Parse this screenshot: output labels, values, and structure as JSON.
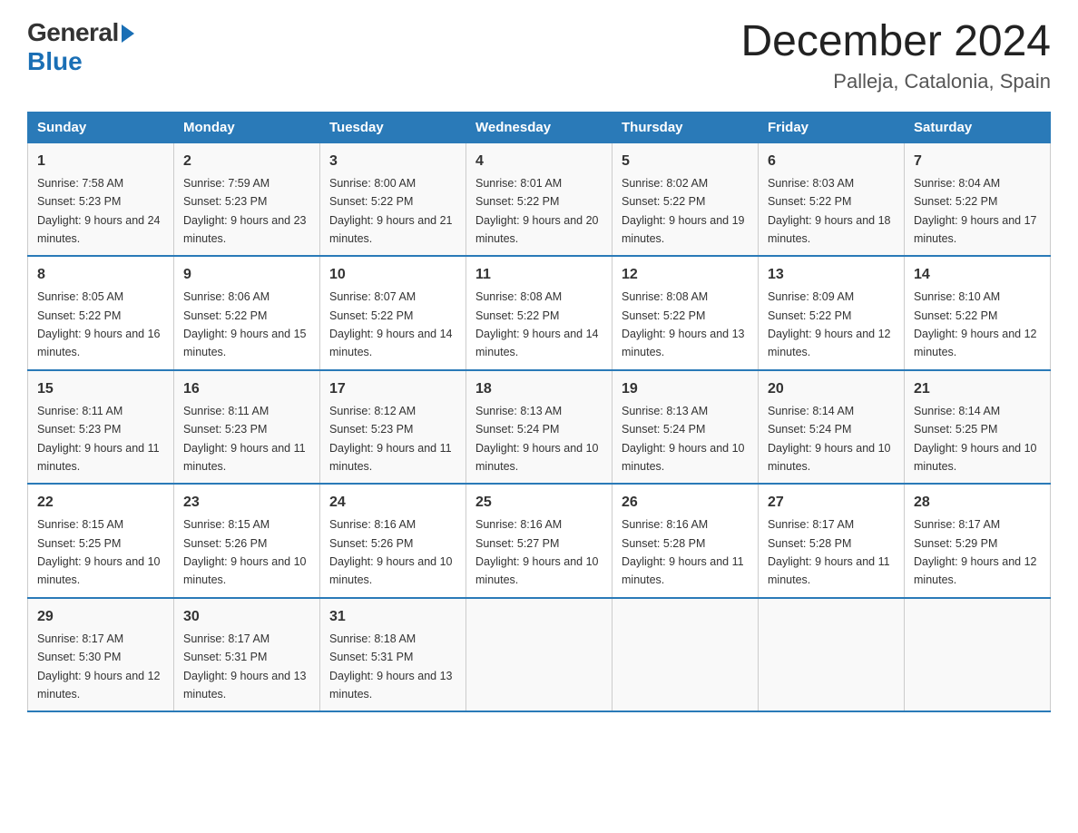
{
  "header": {
    "logo_general": "General",
    "logo_blue": "Blue",
    "title": "December 2024",
    "subtitle": "Palleja, Catalonia, Spain"
  },
  "days_of_week": [
    "Sunday",
    "Monday",
    "Tuesday",
    "Wednesday",
    "Thursday",
    "Friday",
    "Saturday"
  ],
  "weeks": [
    [
      {
        "day": "1",
        "sunrise": "7:58 AM",
        "sunset": "5:23 PM",
        "daylight": "9 hours and 24 minutes."
      },
      {
        "day": "2",
        "sunrise": "7:59 AM",
        "sunset": "5:23 PM",
        "daylight": "9 hours and 23 minutes."
      },
      {
        "day": "3",
        "sunrise": "8:00 AM",
        "sunset": "5:22 PM",
        "daylight": "9 hours and 21 minutes."
      },
      {
        "day": "4",
        "sunrise": "8:01 AM",
        "sunset": "5:22 PM",
        "daylight": "9 hours and 20 minutes."
      },
      {
        "day": "5",
        "sunrise": "8:02 AM",
        "sunset": "5:22 PM",
        "daylight": "9 hours and 19 minutes."
      },
      {
        "day": "6",
        "sunrise": "8:03 AM",
        "sunset": "5:22 PM",
        "daylight": "9 hours and 18 minutes."
      },
      {
        "day": "7",
        "sunrise": "8:04 AM",
        "sunset": "5:22 PM",
        "daylight": "9 hours and 17 minutes."
      }
    ],
    [
      {
        "day": "8",
        "sunrise": "8:05 AM",
        "sunset": "5:22 PM",
        "daylight": "9 hours and 16 minutes."
      },
      {
        "day": "9",
        "sunrise": "8:06 AM",
        "sunset": "5:22 PM",
        "daylight": "9 hours and 15 minutes."
      },
      {
        "day": "10",
        "sunrise": "8:07 AM",
        "sunset": "5:22 PM",
        "daylight": "9 hours and 14 minutes."
      },
      {
        "day": "11",
        "sunrise": "8:08 AM",
        "sunset": "5:22 PM",
        "daylight": "9 hours and 14 minutes."
      },
      {
        "day": "12",
        "sunrise": "8:08 AM",
        "sunset": "5:22 PM",
        "daylight": "9 hours and 13 minutes."
      },
      {
        "day": "13",
        "sunrise": "8:09 AM",
        "sunset": "5:22 PM",
        "daylight": "9 hours and 12 minutes."
      },
      {
        "day": "14",
        "sunrise": "8:10 AM",
        "sunset": "5:22 PM",
        "daylight": "9 hours and 12 minutes."
      }
    ],
    [
      {
        "day": "15",
        "sunrise": "8:11 AM",
        "sunset": "5:23 PM",
        "daylight": "9 hours and 11 minutes."
      },
      {
        "day": "16",
        "sunrise": "8:11 AM",
        "sunset": "5:23 PM",
        "daylight": "9 hours and 11 minutes."
      },
      {
        "day": "17",
        "sunrise": "8:12 AM",
        "sunset": "5:23 PM",
        "daylight": "9 hours and 11 minutes."
      },
      {
        "day": "18",
        "sunrise": "8:13 AM",
        "sunset": "5:24 PM",
        "daylight": "9 hours and 10 minutes."
      },
      {
        "day": "19",
        "sunrise": "8:13 AM",
        "sunset": "5:24 PM",
        "daylight": "9 hours and 10 minutes."
      },
      {
        "day": "20",
        "sunrise": "8:14 AM",
        "sunset": "5:24 PM",
        "daylight": "9 hours and 10 minutes."
      },
      {
        "day": "21",
        "sunrise": "8:14 AM",
        "sunset": "5:25 PM",
        "daylight": "9 hours and 10 minutes."
      }
    ],
    [
      {
        "day": "22",
        "sunrise": "8:15 AM",
        "sunset": "5:25 PM",
        "daylight": "9 hours and 10 minutes."
      },
      {
        "day": "23",
        "sunrise": "8:15 AM",
        "sunset": "5:26 PM",
        "daylight": "9 hours and 10 minutes."
      },
      {
        "day": "24",
        "sunrise": "8:16 AM",
        "sunset": "5:26 PM",
        "daylight": "9 hours and 10 minutes."
      },
      {
        "day": "25",
        "sunrise": "8:16 AM",
        "sunset": "5:27 PM",
        "daylight": "9 hours and 10 minutes."
      },
      {
        "day": "26",
        "sunrise": "8:16 AM",
        "sunset": "5:28 PM",
        "daylight": "9 hours and 11 minutes."
      },
      {
        "day": "27",
        "sunrise": "8:17 AM",
        "sunset": "5:28 PM",
        "daylight": "9 hours and 11 minutes."
      },
      {
        "day": "28",
        "sunrise": "8:17 AM",
        "sunset": "5:29 PM",
        "daylight": "9 hours and 12 minutes."
      }
    ],
    [
      {
        "day": "29",
        "sunrise": "8:17 AM",
        "sunset": "5:30 PM",
        "daylight": "9 hours and 12 minutes."
      },
      {
        "day": "30",
        "sunrise": "8:17 AM",
        "sunset": "5:31 PM",
        "daylight": "9 hours and 13 minutes."
      },
      {
        "day": "31",
        "sunrise": "8:18 AM",
        "sunset": "5:31 PM",
        "daylight": "9 hours and 13 minutes."
      },
      {
        "day": "",
        "sunrise": "",
        "sunset": "",
        "daylight": ""
      },
      {
        "day": "",
        "sunrise": "",
        "sunset": "",
        "daylight": ""
      },
      {
        "day": "",
        "sunrise": "",
        "sunset": "",
        "daylight": ""
      },
      {
        "day": "",
        "sunrise": "",
        "sunset": "",
        "daylight": ""
      }
    ]
  ],
  "labels": {
    "sunrise_prefix": "Sunrise: ",
    "sunset_prefix": "Sunset: ",
    "daylight_prefix": "Daylight: "
  }
}
